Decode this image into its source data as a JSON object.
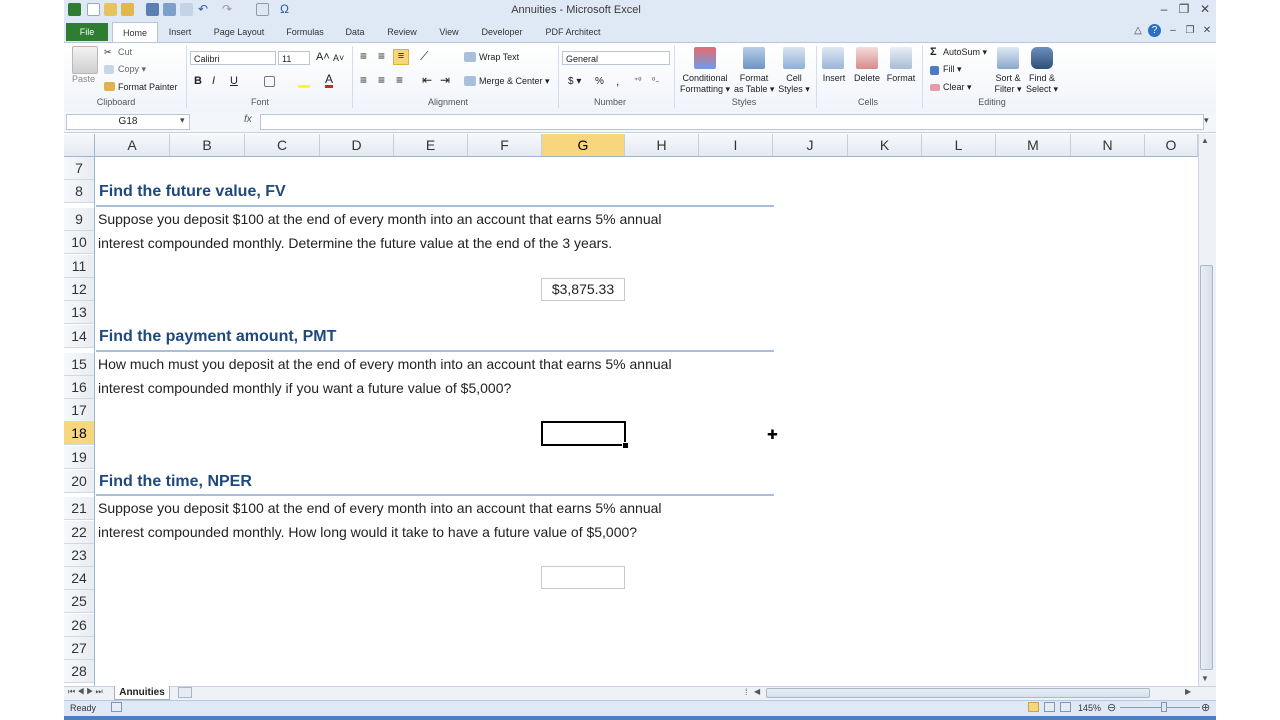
{
  "window": {
    "title": "Annuities  -  Microsoft Excel",
    "controls": [
      "‒",
      "❐",
      "✕"
    ]
  },
  "ribbon_tabs": [
    "File",
    "Home",
    "Insert",
    "Page Layout",
    "Formulas",
    "Data",
    "Review",
    "View",
    "Developer",
    "PDF Architect"
  ],
  "ribbon": {
    "clipboard": {
      "paste": "Paste",
      "cut": "Cut",
      "copy": "Copy ▾",
      "format_painter": "Format Painter",
      "label": "Clipboard"
    },
    "font": {
      "name": "Calibri",
      "size": "11",
      "bold": "B",
      "italic": "I",
      "underline": "U",
      "label": "Font"
    },
    "alignment": {
      "wrap": "Wrap Text",
      "merge": "Merge & Center ▾",
      "label": "Alignment"
    },
    "number": {
      "format": "General",
      "currency": "$ ▾",
      "percent": "%",
      "comma": ",",
      "label": "Number"
    },
    "styles": {
      "conditional": [
        "Conditional",
        "Formatting ▾"
      ],
      "format_table": [
        "Format",
        "as Table ▾"
      ],
      "cell_styles": [
        "Cell",
        "Styles ▾"
      ],
      "label": "Styles"
    },
    "cells": {
      "insert": "Insert",
      "delete": "Delete",
      "format": "Format",
      "label": "Cells"
    },
    "editing": {
      "autosum": "AutoSum ▾",
      "fill": "Fill ▾",
      "clear": "Clear ▾",
      "sort": [
        "Sort &",
        "Filter ▾"
      ],
      "find": [
        "Find &",
        "Select ▾"
      ],
      "label": "Editing"
    }
  },
  "formula_bar": {
    "name_box": "G18",
    "fx": "fx",
    "formula": ""
  },
  "columns": [
    "A",
    "B",
    "C",
    "D",
    "E",
    "F",
    "G",
    "H",
    "I",
    "J",
    "K",
    "L",
    "M",
    "N",
    "O"
  ],
  "selected_column": "G",
  "rows": [
    "7",
    "8",
    "9",
    "10",
    "11",
    "12",
    "13",
    "14",
    "15",
    "16",
    "17",
    "18",
    "19",
    "20",
    "21",
    "22",
    "23",
    "24",
    "25",
    "26",
    "27",
    "28"
  ],
  "selected_row": "18",
  "content": {
    "s1": {
      "heading": "Find the future value, FV",
      "line1": "Suppose you deposit $100 at the end of every month into an account that earns 5% annual",
      "line2": "interest compounded monthly. Determine the future value at the end of the 3 years.",
      "answer": "$3,875.33"
    },
    "s2": {
      "heading": "Find the payment amount, PMT",
      "line1": "How much must you deposit at the end of every month into an account that earns 5% annual",
      "line2": "interest compounded monthly if you want a future value of $5,000?",
      "answer": ""
    },
    "s3": {
      "heading": "Find the time, NPER",
      "line1": "Suppose you deposit $100 at the end of every month into an account that earns 5% annual",
      "line2": "interest compounded monthly. How long would it take to have a future value of $5,000?",
      "answer": ""
    }
  },
  "sheet_tabs": {
    "active": "Annuities"
  },
  "status": {
    "ready": "Ready",
    "zoom": "145%"
  },
  "colors": {
    "heading": "#1f497d",
    "selection_header": "#f8d67e",
    "file_tab": "#2e7d32"
  }
}
